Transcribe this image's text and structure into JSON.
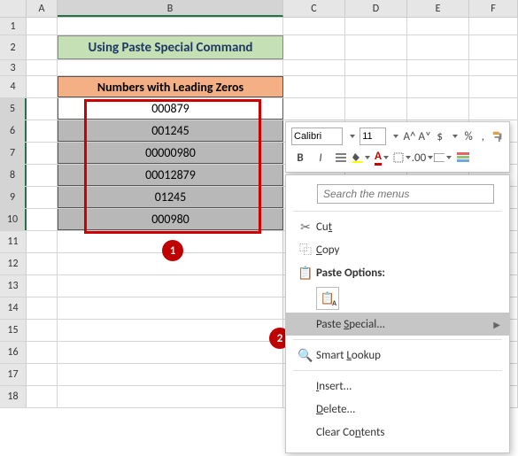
{
  "columns": [
    "A",
    "B",
    "C",
    "D",
    "E",
    "F"
  ],
  "rows": [
    "1",
    "2",
    "3",
    "4",
    "5",
    "6",
    "7",
    "8",
    "9",
    "10",
    "11",
    "12",
    "13",
    "14",
    "15",
    "16",
    "17",
    "18"
  ],
  "title": "Using Paste Special Command",
  "table_header": "Numbers with Leading Zeros",
  "data": [
    "000879",
    "001245",
    "00000980",
    "00012879",
    "01245",
    "000980"
  ],
  "badge1": "1",
  "badge2": "2",
  "toolbar": {
    "font": "Calibri",
    "size": "11",
    "bold": "B",
    "italic": "I",
    "dollar": "$",
    "percent": "%",
    "comma": ","
  },
  "menu": {
    "search_placeholder": "Search the menus",
    "cut": "Cut",
    "copy": "Copy",
    "paste_options": "Paste Options:",
    "paste_special": "Paste Special...",
    "smart_lookup": "Smart Lookup",
    "insert": "Insert...",
    "delete": "Delete...",
    "clear": "Clear Contents"
  }
}
